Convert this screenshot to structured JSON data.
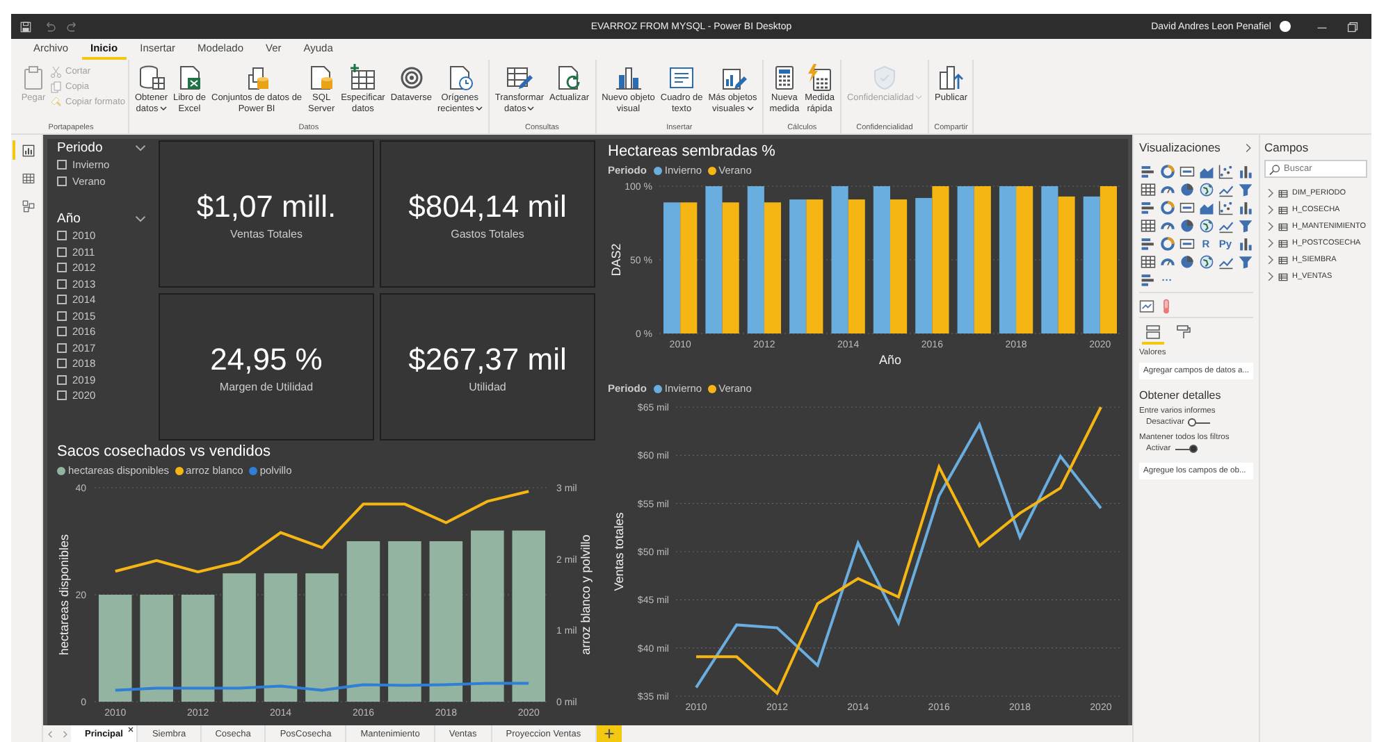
{
  "title_bar": {
    "title": "EVARROZ FROM MYSQL - Power BI Desktop",
    "user": "David Andres Leon Penafiel"
  },
  "menu_tabs": [
    {
      "label": "Archivo",
      "selected": false
    },
    {
      "label": "Inicio",
      "selected": true
    },
    {
      "label": "Insertar",
      "selected": false
    },
    {
      "label": "Modelado",
      "selected": false
    },
    {
      "label": "Ver",
      "selected": false
    },
    {
      "label": "Ayuda",
      "selected": false
    }
  ],
  "ribbon_groups": [
    {
      "label": "Portapapeles",
      "buttons": [
        {
          "kind": "large",
          "label": "Pegar",
          "disabled": true,
          "dropdown": false
        },
        {
          "kind": "small",
          "label": "Cortar",
          "disabled": true
        },
        {
          "kind": "small",
          "label": "Copia",
          "disabled": true
        },
        {
          "kind": "small",
          "label": "Copiar formato",
          "disabled": true
        }
      ]
    },
    {
      "label": "Datos",
      "buttons": [
        {
          "kind": "large",
          "label": "Obtener\ndatos",
          "disabled": false,
          "dropdown": true
        },
        {
          "kind": "large",
          "label": "Libro de\nExcel",
          "disabled": false,
          "dropdown": false
        },
        {
          "kind": "large",
          "label": "Conjuntos de datos de\nPower BI",
          "disabled": false,
          "dropdown": false
        },
        {
          "kind": "large",
          "label": "SQL\nServer",
          "disabled": false,
          "dropdown": false
        },
        {
          "kind": "large",
          "label": "Especificar\ndatos",
          "disabled": false,
          "dropdown": false
        },
        {
          "kind": "large",
          "label": "Dataverse",
          "disabled": false,
          "dropdown": false
        },
        {
          "kind": "large",
          "label": "Orígenes\nrecientes",
          "disabled": false,
          "dropdown": true
        }
      ]
    },
    {
      "label": "Consultas",
      "buttons": [
        {
          "kind": "large",
          "label": "Transformar\ndatos",
          "disabled": false,
          "dropdown": true
        },
        {
          "kind": "large",
          "label": "Actualizar",
          "disabled": false,
          "dropdown": false
        }
      ]
    },
    {
      "label": "Insertar",
      "buttons": [
        {
          "kind": "large",
          "label": "Nuevo objeto\nvisual",
          "disabled": false,
          "dropdown": false
        },
        {
          "kind": "large",
          "label": "Cuadro de\ntexto",
          "disabled": false,
          "dropdown": false
        },
        {
          "kind": "large",
          "label": "Más objetos\nvisuales",
          "disabled": false,
          "dropdown": true
        }
      ]
    },
    {
      "label": "Cálculos",
      "buttons": [
        {
          "kind": "large",
          "label": "Nueva\nmedida",
          "disabled": false,
          "dropdown": false
        },
        {
          "kind": "large",
          "label": "Medida\nrápida",
          "disabled": false,
          "dropdown": false
        }
      ]
    },
    {
      "label": "Confidencialidad",
      "buttons": [
        {
          "kind": "large",
          "label": "Confidencialidad",
          "disabled": true,
          "dropdown": true
        }
      ]
    },
    {
      "label": "Compartir",
      "buttons": [
        {
          "kind": "large",
          "label": "Publicar",
          "disabled": false,
          "dropdown": false
        }
      ]
    }
  ],
  "views": [
    {
      "selected": true
    },
    {
      "selected": false
    },
    {
      "selected": false
    }
  ],
  "slicers": [
    {
      "title": "Periodo",
      "items": [
        {
          "label": "Invierno",
          "checked": false
        },
        {
          "label": "Verano",
          "checked": false
        }
      ]
    },
    {
      "title": "Año",
      "items": [
        {
          "label": "2010",
          "checked": false
        },
        {
          "label": "2011",
          "checked": false
        },
        {
          "label": "2012",
          "checked": false
        },
        {
          "label": "2013",
          "checked": false
        },
        {
          "label": "2014",
          "checked": false
        },
        {
          "label": "2015",
          "checked": false
        },
        {
          "label": "2016",
          "checked": false
        },
        {
          "label": "2017",
          "checked": false
        },
        {
          "label": "2018",
          "checked": false
        },
        {
          "label": "2019",
          "checked": false
        },
        {
          "label": "2020",
          "checked": false
        }
      ]
    }
  ],
  "cards": [
    {
      "value": "$1,07 mill.",
      "label": "Ventas Totales"
    },
    {
      "value": "$804,14 mil",
      "label": "Gastos Totales"
    },
    {
      "value": "24,95 %",
      "label": "Margen de Utilidad"
    },
    {
      "value": "$267,37 mil",
      "label": "Utilidad"
    }
  ],
  "hectareas_chart": {
    "chart_data": {
      "type": "bar",
      "title": "Hectareas sembradas %",
      "legend": "top",
      "grid": true,
      "legend_title": "Periodo",
      "xlabel": "Año",
      "ylabel": "DAS2",
      "categories": [
        "2010",
        null,
        "2012",
        null,
        "2014",
        null,
        "2016",
        null,
        "2018",
        null,
        "2020"
      ],
      "series": [
        {
          "name": "Invierno",
          "color": "#6aaee0",
          "values": [
            89,
            100,
            100,
            91,
            100,
            100,
            92,
            100,
            100,
            100,
            93
          ]
        },
        {
          "name": "Verano",
          "color": "#f5b614",
          "values": [
            89,
            89,
            89,
            91,
            91,
            91,
            100,
            100,
            100,
            93,
            100
          ]
        }
      ],
      "ylim": [
        0,
        100
      ],
      "yticks": [
        {
          "value": 0,
          "label": "0 %"
        },
        {
          "value": 50,
          "label": "50 %"
        },
        {
          "value": 100,
          "label": "100 %"
        }
      ]
    }
  },
  "sacos_chart": {
    "chart_data": {
      "type": "bar",
      "title": "Sacos cosechados vs vendidos",
      "legend": "top",
      "grid": true,
      "ylabel": "hectareas disponibles",
      "y2label": "arroz blanco y polvillo",
      "categories": [
        "2010",
        null,
        "2012",
        null,
        "2014",
        null,
        "2016",
        null,
        "2018",
        null,
        "2020"
      ],
      "series": [
        {
          "name": "hectareas disponibles",
          "color": "#93b4a0",
          "type": "bar",
          "values": [
            20,
            20,
            20,
            24,
            24,
            24,
            30,
            30,
            30,
            32,
            32
          ]
        },
        {
          "name": "arroz blanco",
          "color": "#f5b614",
          "type": "line",
          "axis": "y2",
          "values": [
            1.83,
            1.98,
            1.82,
            1.96,
            2.37,
            2.16,
            2.77,
            2.77,
            2.51,
            2.81,
            2.95
          ]
        },
        {
          "name": "polvillo",
          "color": "#2f7fd6",
          "type": "line",
          "axis": "y2",
          "values": [
            0.16,
            0.19,
            0.19,
            0.19,
            0.22,
            0.16,
            0.24,
            0.23,
            0.24,
            0.26,
            0.26
          ]
        }
      ],
      "ylim": [
        0,
        40
      ],
      "yticks": [
        0,
        20,
        40
      ],
      "y2lim": [
        0,
        3
      ],
      "y2ticks": [
        {
          "value": 0,
          "label": "0 mil"
        },
        {
          "value": 1,
          "label": "1 mil"
        },
        {
          "value": 2,
          "label": "2 mil"
        },
        {
          "value": 3,
          "label": "3 mil"
        }
      ]
    }
  },
  "ventas_chart": {
    "chart_data": {
      "type": "line",
      "legend": "top",
      "grid": true,
      "legend_title": "Periodo",
      "ylabel": "Ventas totales",
      "categories": [
        "2010",
        null,
        "2012",
        null,
        "2014",
        null,
        "2016",
        null,
        "2018",
        null,
        "2020"
      ],
      "series": [
        {
          "name": "Invierno",
          "color": "#6aaee0",
          "values": [
            35.9,
            42.4,
            42.1,
            38.2,
            50.9,
            42.6,
            55.8,
            63.2,
            51.5,
            59.9,
            54.5
          ]
        },
        {
          "name": "Verano",
          "color": "#f5b614",
          "values": [
            39.1,
            39.1,
            35.3,
            44.6,
            47.2,
            45.3,
            58.8,
            50.6,
            54.0,
            56.6,
            65.0
          ]
        }
      ],
      "ylim": [
        35,
        65
      ],
      "yticks": [
        {
          "value": 35,
          "label": "$35 mil"
        },
        {
          "value": 40,
          "label": "$40 mil"
        },
        {
          "value": 45,
          "label": "$45 mil"
        },
        {
          "value": 50,
          "label": "$50 mil"
        },
        {
          "value": 55,
          "label": "$55 mil"
        },
        {
          "value": 60,
          "label": "$60 mil"
        },
        {
          "value": 65,
          "label": "$65 mil"
        }
      ]
    }
  },
  "page_tabs": [
    {
      "label": "Principal",
      "selected": true
    },
    {
      "label": "Siembra",
      "selected": false
    },
    {
      "label": "Cosecha",
      "selected": false
    },
    {
      "label": "PosCosecha",
      "selected": false
    },
    {
      "label": "Mantenimiento",
      "selected": false
    },
    {
      "label": "Ventas",
      "selected": false
    },
    {
      "label": "Proyeccion Ventas",
      "selected": false
    }
  ],
  "visualizations": {
    "title": "Visualizaciones",
    "gallery": [
      {
        "kind": "icon"
      },
      {
        "kind": "icon"
      },
      {
        "kind": "icon"
      },
      {
        "kind": "icon"
      },
      {
        "kind": "icon"
      },
      {
        "kind": "icon"
      },
      {
        "kind": "icon"
      },
      {
        "kind": "icon"
      },
      {
        "kind": "icon"
      },
      {
        "kind": "icon"
      },
      {
        "kind": "icon"
      },
      {
        "kind": "icon"
      },
      {
        "kind": "icon"
      },
      {
        "kind": "icon"
      },
      {
        "kind": "icon"
      },
      {
        "kind": "icon"
      },
      {
        "kind": "icon"
      },
      {
        "kind": "icon"
      },
      {
        "kind": "icon"
      },
      {
        "kind": "icon"
      },
      {
        "kind": "icon"
      },
      {
        "kind": "icon"
      },
      {
        "kind": "icon"
      },
      {
        "kind": "icon"
      },
      {
        "kind": "icon"
      },
      {
        "kind": "icon"
      },
      {
        "kind": "icon"
      },
      {
        "kind": "letter",
        "label": "R"
      },
      {
        "kind": "letter",
        "label": "Py"
      },
      {
        "kind": "icon"
      },
      {
        "kind": "icon"
      },
      {
        "kind": "icon"
      },
      {
        "kind": "icon"
      },
      {
        "kind": "icon"
      },
      {
        "kind": "icon"
      },
      {
        "kind": "icon"
      },
      {
        "kind": "icon"
      },
      {
        "kind": "letter",
        "label": "···"
      }
    ],
    "pane_tabs": [
      {
        "selected": true
      },
      {
        "selected": false
      }
    ],
    "well_label": "Valores",
    "well_placeholder": "Agregar campos de datos a...",
    "details_title": "Obtener detalles",
    "toggles": [
      {
        "caption": "Entre varios informes",
        "label": "Desactivar",
        "on": false
      },
      {
        "caption": "Mantener todos los filtros",
        "label": "Activar",
        "on": true
      }
    ],
    "details_placeholder": "Agregue los campos de ob..."
  },
  "fields": {
    "title": "Campos",
    "search_placeholder": "Buscar",
    "tables": [
      {
        "name": "DIM_PERIODO",
        "expanded": false
      },
      {
        "name": "H_COSECHA",
        "expanded": false
      },
      {
        "name": "H_MANTENIMIENTO",
        "expanded": false
      },
      {
        "name": "H_POSTCOSECHA",
        "expanded": false
      },
      {
        "name": "H_SIEMBRA",
        "expanded": false
      },
      {
        "name": "H_VENTAS",
        "expanded": false
      }
    ]
  }
}
